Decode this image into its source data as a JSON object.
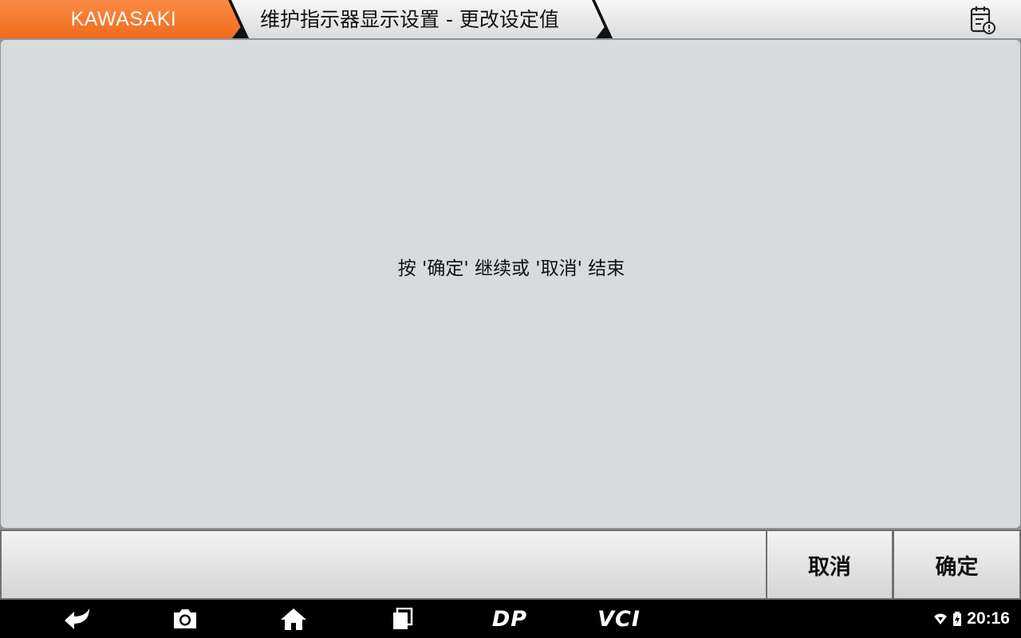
{
  "header": {
    "brand": "KAWASAKI",
    "title": "维护指示器显示设置 - 更改设定值",
    "report_icon": "calendar-alert-icon"
  },
  "main": {
    "message": "按 '确定' 继续或 '取消' 结束"
  },
  "footer": {
    "cancel_label": "取消",
    "confirm_label": "确定"
  },
  "navbar": {
    "icons": [
      "back-icon",
      "camera-icon",
      "home-icon",
      "recent-apps-icon",
      "dp-icon",
      "vci-icon"
    ],
    "dp_label": "DP",
    "vci_label": "VCI"
  },
  "status": {
    "time": "20:16",
    "icons": [
      "wifi-icon",
      "battery-charging-icon"
    ]
  },
  "colors": {
    "brand_orange": "#f27428",
    "panel_bg": "#d7dbde",
    "navbar_bg": "#000000"
  }
}
